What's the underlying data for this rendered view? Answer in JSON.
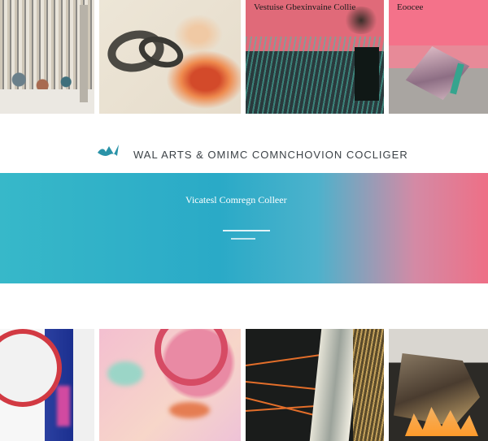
{
  "top_row": {
    "tiles": [
      {
        "caption": ""
      },
      {
        "caption": ""
      },
      {
        "caption": "Vestuise Gbexinvaine Collie"
      },
      {
        "caption": "Eoocee"
      }
    ]
  },
  "header": {
    "logo_icon": "wave-logo-icon",
    "brand_text": "WAL ARTS & OMIMC COMNCHOVION COCLIGER"
  },
  "banner": {
    "title": "Vicatesl Comregn Colleer",
    "gradient_colors": [
      "#37b8c9",
      "#2aaac7",
      "#d48aa5",
      "#ee6f86"
    ]
  },
  "bottom_row": {
    "tiles": [
      {
        "caption": ""
      },
      {
        "caption": ""
      },
      {
        "caption": ""
      },
      {
        "caption": ""
      }
    ]
  }
}
